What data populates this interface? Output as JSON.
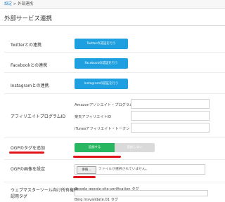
{
  "breadcrumb": {
    "root": "設定",
    "separator": ">",
    "current": "外部連携"
  },
  "page_title": "外部サービス連携",
  "twitter": {
    "label": "Twitterとの連携",
    "button": "Twitterの認証を行う"
  },
  "facebook": {
    "label": "Facebookとの連携",
    "button": "Facebookの認証を行う"
  },
  "instagram": {
    "label": "Instagramとの連携",
    "button": "Instagramの認証を行う"
  },
  "affiliate": {
    "label": "アフィリエイトプログラムID",
    "fields": [
      {
        "label": "Amazonアソシエイト・プログラムID",
        "value": ""
      },
      {
        "label": "楽天アフィリエイトID",
        "value": ""
      },
      {
        "label": "iTunesアフィリエイト・トークン",
        "value": ""
      }
    ]
  },
  "ogp_tag": {
    "label": "OGPのタグを追加",
    "on_label": "追加する",
    "off_label": "追加しない",
    "selected": "on"
  },
  "ogp_image": {
    "label": "OGPの画像を設定",
    "browse_button": "参照...",
    "status": "ファイルが選択されていません。"
  },
  "webmaster": {
    "label_line1": "ウェブマスターツール向け所有権確",
    "label_line2": "認用タグ",
    "google_label": "Google google-site-verification タグ",
    "bing_label": "Bing msvalidate.01 タグ"
  },
  "colors": {
    "link": "#2a86cd",
    "primary_button": "#1e9fe0",
    "toggle_on": "#28b660",
    "toggle_off": "#dadada",
    "annotation": "#e2141a"
  }
}
